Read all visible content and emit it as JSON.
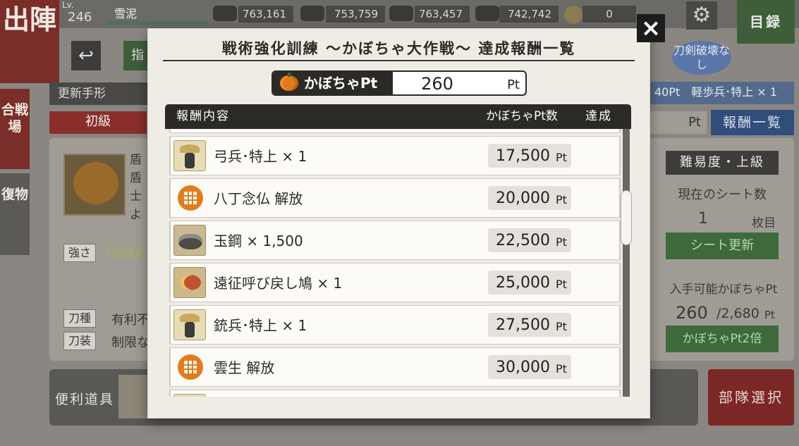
{
  "background": {
    "sortie_label": "出陣",
    "level_label": "Lv.",
    "level": "246",
    "player_name": "雪泥",
    "resources": [
      "763,161",
      "753,759",
      "763,457",
      "742,742"
    ],
    "coins": "0",
    "catalog_label": "目録",
    "combat_tab": "合戦場",
    "recovery_tab": "復物",
    "update_ticket": "更新手形",
    "beginner_tab": "初級",
    "no_break_label": "刀剣破壊なし",
    "reward_preview": "40Pt　軽歩兵･特上 × 1",
    "pt_suffix": "Pt",
    "reward_list_btn": "報酬一覧",
    "difficulty": "難易度・上級",
    "current_sheet_label": "現在のシート数",
    "current_sheet_value": "1",
    "current_sheet_unit": "枚目",
    "sheet_update_btn": "シート更新",
    "obtainable_label": "入手可能かぼちゃPt",
    "obtainable_value": "260",
    "obtainable_total": "/2,680",
    "obtainable_unit": "Pt",
    "double_btn": "かぼちゃPt2倍",
    "strength_label": "強さ",
    "sword_type_label": "刀種",
    "sword_type_text": "有利不",
    "equip_label": "刀装",
    "equip_text": "制限な",
    "desc_lines": [
      "盾",
      "盾",
      "士",
      "よ"
    ],
    "tools_label": "便利道具",
    "party_select_btn": "部隊選択"
  },
  "modal": {
    "title": "戦術強化訓練 〜かぼちゃ大作戦〜 達成報酬一覧",
    "close_symbol": "×",
    "pt_label": "かぼちゃPt",
    "pt_value": "260",
    "pt_unit": "Pt",
    "table_headers": {
      "content": "報酬内容",
      "points": "かぼちゃPt数",
      "done": "達成"
    },
    "rows": [
      {
        "icon": "archer-soldier-icon",
        "text": "弓兵･特上 × 1",
        "points": "17,500",
        "unit": "Pt"
      },
      {
        "icon": "unlock-grid-icon",
        "text": "八丁念仏 解放",
        "points": "20,000",
        "unit": "Pt"
      },
      {
        "icon": "tamahagane-steel-icon",
        "text": "玉鋼 × 1,500",
        "points": "22,500",
        "unit": "Pt"
      },
      {
        "icon": "return-pigeon-icon",
        "text": "遠征呼び戻し鳩 × 1",
        "points": "25,000",
        "unit": "Pt"
      },
      {
        "icon": "gunner-soldier-icon",
        "text": "銃兵･特上 × 1",
        "points": "27,500",
        "unit": "Pt"
      },
      {
        "icon": "unlock-grid-icon",
        "text": "雲生 解放",
        "points": "30,000",
        "unit": "Pt"
      }
    ]
  }
}
